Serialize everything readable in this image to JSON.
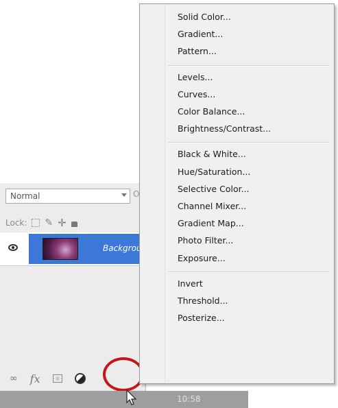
{
  "layers_panel": {
    "blend_mode": "Normal",
    "opacity_stub": "O",
    "lock_label": "Lock:",
    "layer_name": "Background"
  },
  "adjustment_menu": {
    "groups": [
      [
        "Solid Color...",
        "Gradient...",
        "Pattern..."
      ],
      [
        "Levels...",
        "Curves...",
        "Color Balance...",
        "Brightness/Contrast..."
      ],
      [
        "Black & White...",
        "Hue/Saturation...",
        "Selective Color...",
        "Channel Mixer...",
        "Gradient Map...",
        "Photo Filter...",
        "Exposure..."
      ],
      [
        "Invert",
        "Threshold...",
        "Posterize..."
      ]
    ]
  },
  "status_bar": {
    "time": "10:58"
  },
  "icons": {
    "visibility": "eye-icon",
    "link": "link-icon",
    "fx": "fx-icon",
    "mask": "layer-mask-icon",
    "adjustment": "adjustment-layer-icon",
    "cursor": "mouse-cursor-icon"
  },
  "colors": {
    "selection_blue": "#3b78d8",
    "highlight_ring": "#c4161c",
    "menu_bg": "#f0f0f0"
  }
}
